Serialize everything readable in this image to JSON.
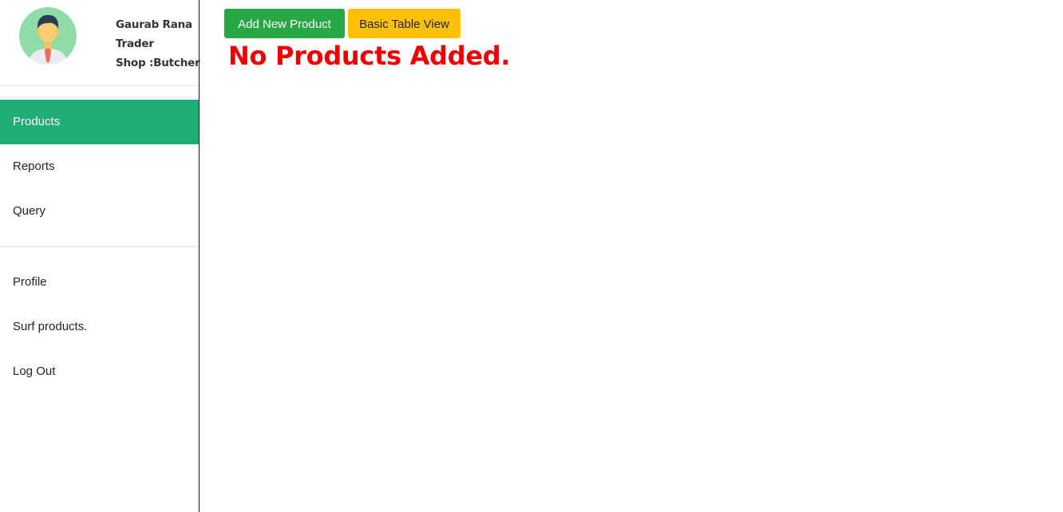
{
  "user": {
    "name": "Gaurab Rana",
    "role": "Trader",
    "shop": "Shop :Butcher"
  },
  "sidebar": {
    "primary_items": [
      {
        "label": "Products",
        "active": true
      },
      {
        "label": "Reports",
        "active": false
      },
      {
        "label": "Query",
        "active": false
      }
    ],
    "secondary_items": [
      {
        "label": "Profile"
      },
      {
        "label": "Surf products."
      },
      {
        "label": "Log Out"
      }
    ]
  },
  "toolbar": {
    "add_product_label": "Add New Product",
    "table_view_label": "Basic Table View"
  },
  "main": {
    "empty_message": "No Products Added."
  },
  "colors": {
    "active_nav": "#1fae77",
    "add_button": "#28a745",
    "table_view_button": "#ffc107",
    "empty_message": "#ee0000"
  }
}
